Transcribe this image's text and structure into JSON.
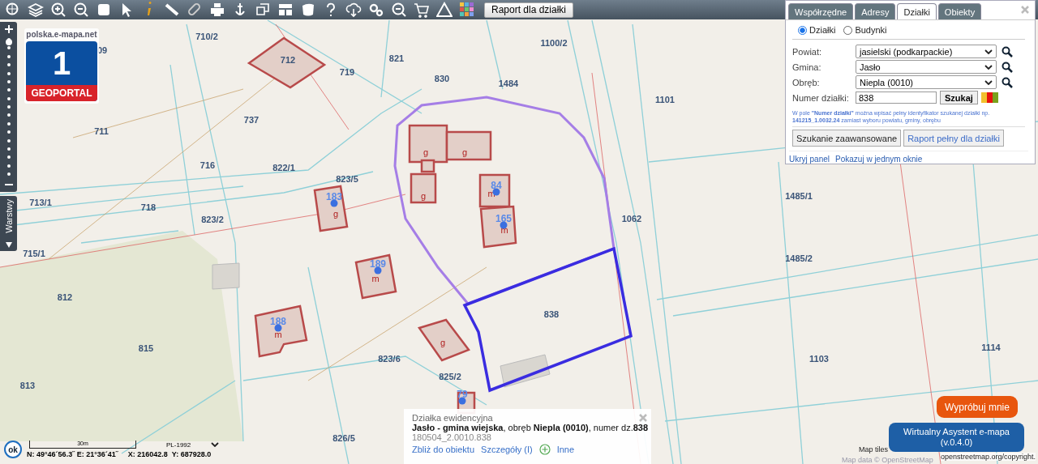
{
  "toolbar": {
    "report_button": "Raport dla działki"
  },
  "logo": {
    "site": "polska.e-mapa.net",
    "number": "1",
    "name": "GEOPORTAL"
  },
  "zoom": {
    "level": 0.88
  },
  "layers_tab": {
    "label": "Warstwy"
  },
  "search_panel": {
    "tabs": [
      {
        "label": "Współrzędne",
        "selected": false
      },
      {
        "label": "Adresy",
        "selected": false
      },
      {
        "label": "Działki",
        "selected": true
      },
      {
        "label": "Obiekty",
        "selected": false
      }
    ],
    "modes": [
      {
        "label": "Działki",
        "selected": true
      },
      {
        "label": "Budynki",
        "selected": false
      }
    ],
    "fields": [
      {
        "label": "Powiat:",
        "value": "jasielski (podkarpackie)"
      },
      {
        "label": "Gmina:",
        "value": "Jasło"
      },
      {
        "label": "Obręb:",
        "value": "Niepla (0010)"
      }
    ],
    "parcel_number": {
      "label": "Numer działki:",
      "value": "838"
    },
    "search_button": "Szukaj",
    "swatches": [
      {
        "color": "#f2c12e"
      },
      {
        "color": "#e8140e"
      },
      {
        "color": "#7aa21c"
      }
    ],
    "hint": "W pole **\"Numer działki\"** można wpisać pełny identyfikator szukanej działki np. **141215_1.0032.24** zamiast wyboru powiatu, gminy, obrębu",
    "buttons": [
      "Szukanie zaawansowane",
      "Raport pełny dla działki"
    ],
    "links": [
      "Ukryj panel",
      "Pokazuj w jednym oknie"
    ]
  },
  "map_labels": [
    {
      "kind": "parcel",
      "text": "710/2"
    },
    {
      "kind": "parcel",
      "text": "09"
    },
    {
      "kind": "parcel",
      "text": "712"
    },
    {
      "kind": "parcel",
      "text": "821"
    },
    {
      "kind": "parcel",
      "text": "1100/2"
    },
    {
      "kind": "parcel",
      "text": "719"
    },
    {
      "kind": "parcel",
      "text": "830"
    },
    {
      "kind": "parcel",
      "text": "1484"
    },
    {
      "kind": "parcel",
      "text": "1101"
    },
    {
      "kind": "parcel",
      "text": "711"
    },
    {
      "kind": "parcel",
      "text": "737"
    },
    {
      "kind": "parcel",
      "text": "716"
    },
    {
      "kind": "parcel",
      "text": "822/1"
    },
    {
      "kind": "parcel",
      "text": "823/5"
    },
    {
      "kind": "parcel",
      "text": "1062"
    },
    {
      "kind": "parcel",
      "text": "1485/1"
    },
    {
      "kind": "parcel",
      "text": "713/1"
    },
    {
      "kind": "parcel",
      "text": "718"
    },
    {
      "kind": "parcel",
      "text": "823/2"
    },
    {
      "kind": "parcel",
      "text": "715/1"
    },
    {
      "kind": "parcel",
      "text": "1485/2"
    },
    {
      "kind": "parcel",
      "text": "812"
    },
    {
      "kind": "parcel",
      "text": "838"
    },
    {
      "kind": "parcel",
      "text": "815"
    },
    {
      "kind": "parcel",
      "text": "823/6"
    },
    {
      "kind": "parcel",
      "text": "1103"
    },
    {
      "kind": "parcel",
      "text": "1114"
    },
    {
      "kind": "parcel",
      "text": "813"
    },
    {
      "kind": "parcel",
      "text": "825/2"
    },
    {
      "kind": "parcel",
      "text": "826/5"
    },
    {
      "kind": "building",
      "text": "g"
    },
    {
      "kind": "building",
      "text": "g"
    },
    {
      "kind": "building",
      "text": "g"
    },
    {
      "kind": "building",
      "text": "g"
    },
    {
      "kind": "building",
      "text": "m"
    },
    {
      "kind": "building",
      "text": "m"
    },
    {
      "kind": "building",
      "text": "m"
    },
    {
      "kind": "building",
      "text": "m"
    },
    {
      "kind": "building",
      "text": "g"
    },
    {
      "kind": "address",
      "text": "183"
    },
    {
      "kind": "address",
      "text": "84"
    },
    {
      "kind": "address",
      "text": "165"
    },
    {
      "kind": "address",
      "text": "189"
    },
    {
      "kind": "address",
      "text": "188"
    },
    {
      "kind": "address",
      "text": "79"
    }
  ],
  "popup": {
    "title": "Działka ewidencyjna",
    "description": "**Jasło - gmina wiejska**, obręb **Niepla (0010)**, numer dz.**838**",
    "identifier": "180504_2.0010.838",
    "links": [
      "Zbliż do obiektu",
      "Szczegóły (I)",
      "Inne"
    ]
  },
  "status": {
    "ok": "ok",
    "scale": "30m",
    "projection": "PL-1992",
    "geo": "N: 49°46´56.3˝  E: 21°36´41˝",
    "x": "X: 216042.8",
    "y": "Y: 687928.0"
  },
  "assistant": {
    "prompt": "Wypróbuj mnie",
    "title": "Wirtualny Asystent e-mapa",
    "version": "(v.0.4.0)"
  },
  "attribution": {
    "tiles": "Map tiles",
    "data": "Map data © OpenStreetMap",
    "link": "openstreetmap.org/copyright."
  }
}
